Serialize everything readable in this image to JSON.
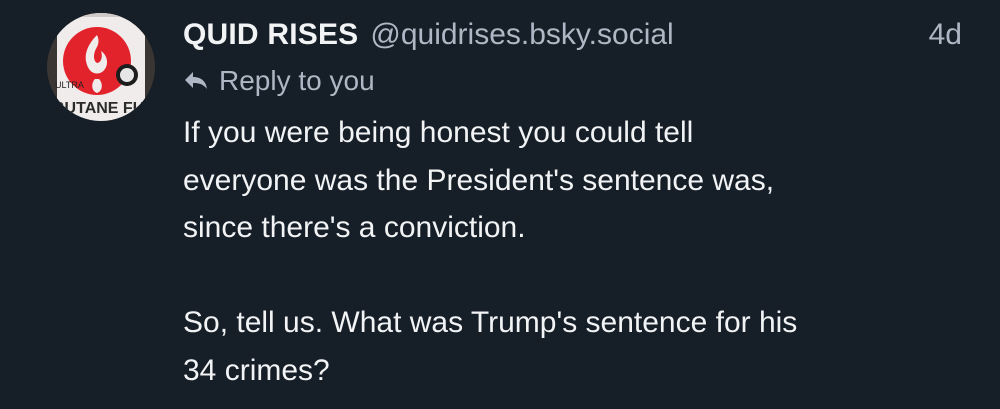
{
  "post": {
    "author": {
      "display_name": "QUID RISES",
      "handle": "@quidrises.bsky.social",
      "avatar_icon": "butane-fuel-can-icon",
      "avatar_text": {
        "small": "ULTRA",
        "large": "BUTANE FUEL"
      }
    },
    "timestamp": "4d",
    "reply_context": {
      "icon": "reply-arrow-icon",
      "label": "Reply to you"
    },
    "body": {
      "paragraphs": [
        "If you were being honest you could tell\neveryone was the President's sentence was,\nsince there's a conviction.",
        "So, tell us. What was Trump's sentence for his\n34 crimes?"
      ]
    }
  },
  "colors": {
    "background": "#161e27",
    "primary_text": "#f1f3f5",
    "secondary_text": "#aeb8c4",
    "avatar_red": "#e3232c"
  }
}
